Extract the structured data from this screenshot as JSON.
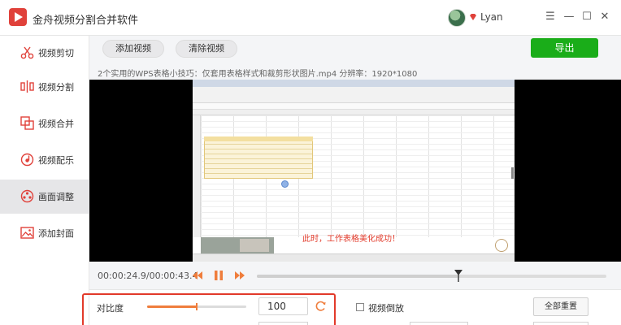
{
  "app": {
    "title": "金舟视频分割合并软件",
    "user": "Lyan"
  },
  "window_controls": {
    "menu": "☰",
    "minimize": "—",
    "maximize": "☐",
    "close": "✕"
  },
  "sidebar": {
    "items": [
      {
        "label": "视频剪切",
        "icon": "scissors-icon"
      },
      {
        "label": "视频分割",
        "icon": "split-icon"
      },
      {
        "label": "视频合并",
        "icon": "merge-icon"
      },
      {
        "label": "视频配乐",
        "icon": "music-icon"
      },
      {
        "label": "画面调整",
        "icon": "picture-adjust-icon",
        "active": true
      },
      {
        "label": "添加封面",
        "icon": "cover-icon"
      }
    ]
  },
  "toolbar": {
    "add_label": "添加视频",
    "clear_label": "清除视频",
    "export_label": "导出"
  },
  "file": {
    "info": "2个实用的WPS表格小技巧：仅套用表格样式和裁剪形状图片.mp4   分辨率：1920*1080"
  },
  "video": {
    "caption": "此时，工作表格美化成功！"
  },
  "player": {
    "time": "00:00:24.9/00:00:43.4",
    "progress": 0.574
  },
  "adjust": {
    "contrast_label": "对比度",
    "contrast_value": "100",
    "contrast_slider": 0.5,
    "reverse_label": "视频倒放",
    "reset_all_label": "全部重置"
  },
  "colors": {
    "accent": "#1aad19",
    "highlight": "#e23a2a",
    "slider": "#ef7d3c",
    "brand": "#e0413a"
  }
}
